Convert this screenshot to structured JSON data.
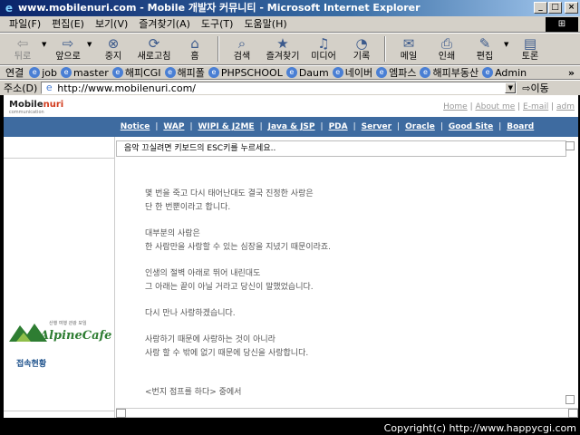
{
  "window": {
    "title": "www.mobilenuri.com - Mobile 개발자 커뮤니티 - Microsoft Internet Explorer",
    "buttons": [
      "_",
      "□",
      "×"
    ]
  },
  "menubar": {
    "items": [
      "파일(F)",
      "편집(E)",
      "보기(V)",
      "즐겨찾기(A)",
      "도구(T)",
      "도움말(H)"
    ]
  },
  "toolbar": {
    "back": "뒤로",
    "forward": "앞으로",
    "stop": "중지",
    "refresh": "새로고침",
    "home": "홈",
    "search": "검색",
    "favorites": "즐겨찾기",
    "media": "미디어",
    "history": "기록",
    "mail": "메일",
    "print": "인쇄",
    "edit": "편집",
    "discuss": "토론"
  },
  "links": {
    "label": "연결",
    "items": [
      "job",
      "master",
      "해피CGI",
      "해피폴",
      "PHPSCHOOL",
      "Daum",
      "네이버",
      "엠파스",
      "해피부동산",
      "Admin"
    ],
    "more": "»"
  },
  "address": {
    "label": "주소(D)",
    "url": "http://www.mobilenuri.com/",
    "go": "이동"
  },
  "site": {
    "logo_main": "Mobile",
    "logo_accent": "nuri",
    "logo_sub": "communication",
    "toplinks": [
      "Home",
      "About me",
      "E-mail",
      "adm"
    ],
    "nav": [
      "Notice",
      "WAP",
      "WIPI & J2ME",
      "Java & JSP",
      "PDA",
      "Server",
      "Oracle",
      "Good Site",
      "Board"
    ],
    "message": "음악 끄실려면 키보드의 ESC키를 누르세요..",
    "poem": [
      [
        "몇 번을 죽고 다시 태어난대도 결국 진정한 사랑은",
        "단 한 번뿐이라고 합니다."
      ],
      [
        "대부분의 사람은",
        "한 사람만을 사랑할 수 있는 심장을 지녔기 때문이라죠."
      ],
      [
        "인생의 절벽 아래로 뛰어 내린대도",
        "그 아래는 끝이 아닐 거라고 당신이 말했었습니다."
      ],
      [
        "다시 만나 사랑하겠습니다."
      ],
      [
        "사랑하기 때문에 사랑하는 것이 아니라",
        "사랑 할 수 밖에 없기 때문에 당신을 사랑합니다."
      ]
    ],
    "poem_source": "<번지 점프를 하다> 중에서",
    "alpine_name": "AlpineCafe",
    "alpine_tag": "산행 여행 관광 모임",
    "visitor": "접속현황"
  },
  "footer": "Copyright(c) http://www.happycgi.com",
  "colors": {
    "titlebar": "#0a246a",
    "chrome": "#d4d0c8",
    "navbar": "#3e6ba0",
    "logo_accent": "#d23c1e",
    "alpine_green": "#2e7d32"
  }
}
